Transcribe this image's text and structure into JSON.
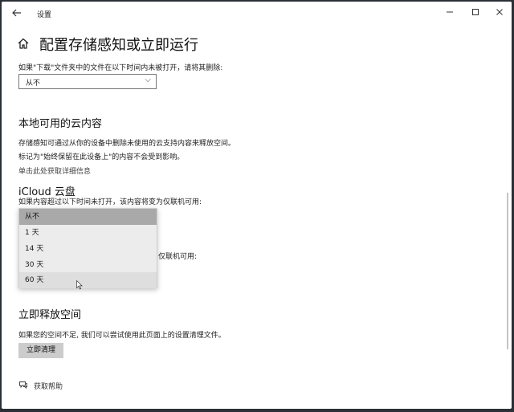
{
  "window": {
    "title": "设置",
    "back_icon": "arrow-left-icon",
    "min_icon": "minimize-icon",
    "max_icon": "maximize-icon",
    "close_icon": "close-icon"
  },
  "page": {
    "title": "配置存储感知或立即运行",
    "home_icon": "home-icon"
  },
  "downloads": {
    "label": "如果\"下载\"文件夹中的文件在以下时间内未被打开，请将其删除:",
    "dropdown_value": "从不"
  },
  "cloud": {
    "heading": "本地可用的云内容",
    "desc1": "存储感知可通过从你的设备中删除未使用的云支持内容来释放空间。",
    "desc2": "标记为\"始终保留在此设备上\"的内容不会受到影响。",
    "learn_more": "单击此处获取详细信息"
  },
  "icloud": {
    "heading": "iCloud 云盘",
    "label": "如果内容超过以下时间未打开，该内容将变为仅联机可用:",
    "hidden_label_tail": "仅联机可用:",
    "options": [
      "从不",
      "1 天",
      "14 天",
      "30 天",
      "60 天"
    ],
    "selected_index": 0,
    "hover_index": 4
  },
  "free_space": {
    "heading": "立即释放空间",
    "desc": "如果您的空间不足, 我们可以尝试使用此页面上的设置清理文件。",
    "button": "立即清理"
  },
  "help": {
    "label": "获取帮助",
    "icon": "help-chat-icon"
  },
  "colors": {
    "popup_bg": "#ececec",
    "selected": "#a9a9a9",
    "button_bg": "#cccccc",
    "desktop": "#2b2f36"
  }
}
